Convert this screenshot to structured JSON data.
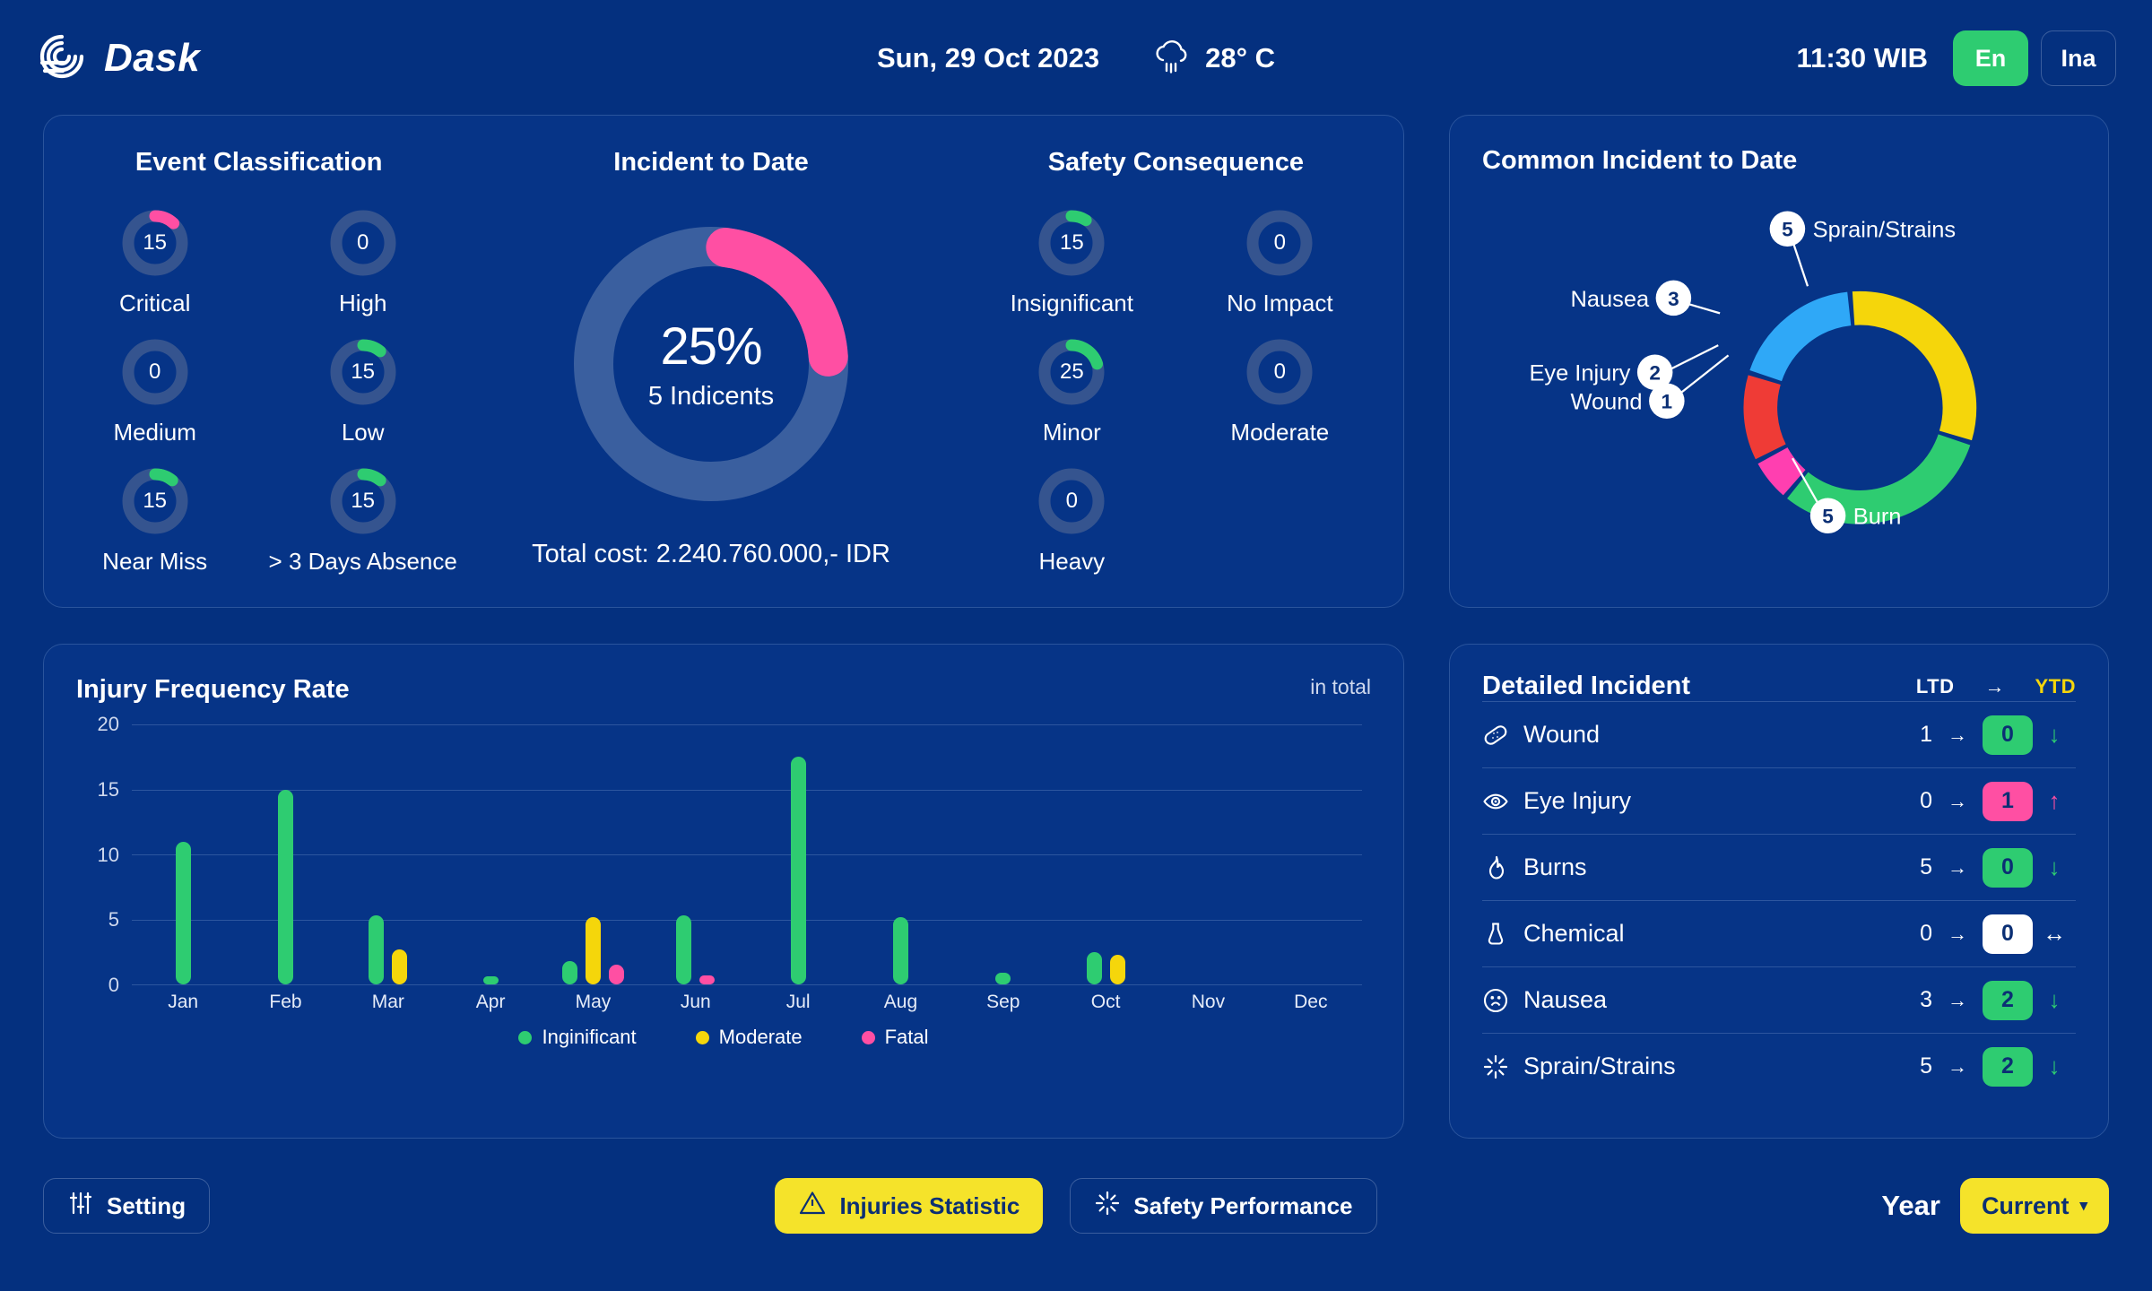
{
  "header": {
    "brand": "Dask",
    "logo_icon": "dask-spiral-logo",
    "date": "Sun, 29 Oct 2023",
    "weather_icon": "rain-cloud-icon",
    "temperature": "28° C",
    "time": "11:30 WIB",
    "lang_active": "En",
    "lang_inactive": "Ina"
  },
  "event_classification": {
    "title": "Event Classification",
    "items": [
      {
        "label": "Critical",
        "value": "15",
        "pct": 12,
        "color": "#ff4fa3"
      },
      {
        "label": "High",
        "value": "0",
        "pct": 0,
        "color": "#2ecc71"
      },
      {
        "label": "Medium",
        "value": "0",
        "pct": 0,
        "color": "#2ecc71"
      },
      {
        "label": "Low",
        "value": "15",
        "pct": 11,
        "color": "#2ecc71"
      },
      {
        "label": "Near Miss",
        "value": "15",
        "pct": 11,
        "color": "#2ecc71"
      },
      {
        "label": "> 3 Days Absence",
        "value": "15",
        "pct": 11,
        "color": "#2ecc71"
      }
    ]
  },
  "incident_to_date": {
    "title": "Incident to Date",
    "percent": "25%",
    "subtitle": "5 Indicents",
    "total_cost": "Total cost: 2.240.760.000,- IDR",
    "arc_pct": 22,
    "arc_color": "#ff4fa3",
    "track_color": "#3a5f9f"
  },
  "safety_consequence": {
    "title": "Safety Consequence",
    "items": [
      {
        "label": "Insignificant",
        "value": "15",
        "pct": 9,
        "color": "#2ecc71"
      },
      {
        "label": "No Impact",
        "value": "0",
        "pct": 0,
        "color": "#2ecc71"
      },
      {
        "label": "Minor",
        "value": "25",
        "pct": 20,
        "color": "#2ecc71"
      },
      {
        "label": "Moderate",
        "value": "0",
        "pct": 0,
        "color": "#2ecc71"
      },
      {
        "label": "Heavy",
        "value": "0",
        "pct": 0,
        "color": "#2ecc71"
      }
    ]
  },
  "common_incident": {
    "title": "Common Incident to Date",
    "chart_data": {
      "type": "pie",
      "title": "Common Incident to Date",
      "categories": [
        "Sprain/Strains",
        "Burn",
        "Wound",
        "Eye Injury",
        "Nausea"
      ],
      "values": [
        5,
        5,
        1,
        2,
        3
      ],
      "colors": [
        "#f5d60b",
        "#2ecc71",
        "#ff3fb0",
        "#ef3b36",
        "#2fa8f7"
      ],
      "legend": "callout-labels"
    },
    "labels": [
      {
        "name": "Sprain/Strains",
        "value": "5"
      },
      {
        "name": "Burn",
        "value": "5"
      },
      {
        "name": "Wound",
        "value": "1"
      },
      {
        "name": "Eye Injury",
        "value": "2"
      },
      {
        "name": "Nausea",
        "value": "3"
      }
    ]
  },
  "injury_chart": {
    "title": "Injury Frequency Rate",
    "total_label": "in total",
    "chart_data": {
      "type": "bar",
      "title": "Injury Frequency Rate",
      "xlabel": "",
      "ylabel": "",
      "ylim": [
        0,
        20
      ],
      "yticks": [
        0,
        5,
        10,
        15,
        20
      ],
      "grid": true,
      "categories": [
        "Jan",
        "Feb",
        "Mar",
        "Apr",
        "May",
        "Jun",
        "Jul",
        "Aug",
        "Sep",
        "Oct",
        "Nov",
        "Dec"
      ],
      "series": [
        {
          "name": "Inginificant",
          "color": "#2ecc71",
          "values": [
            11,
            15,
            5.3,
            0.6,
            1.8,
            5.3,
            17.5,
            5.2,
            0.9,
            2.5,
            0,
            0
          ]
        },
        {
          "name": "Moderate",
          "color": "#f5d60b",
          "values": [
            0,
            0,
            2.7,
            0,
            5.2,
            0,
            0,
            0,
            0,
            2.3,
            0,
            0
          ]
        },
        {
          "name": "Fatal",
          "color": "#ff4fa3",
          "values": [
            0,
            0,
            0,
            0,
            1.5,
            0.7,
            0,
            0,
            0,
            0,
            0,
            0
          ]
        }
      ]
    },
    "legend": [
      {
        "label": "Inginificant",
        "color": "#2ecc71"
      },
      {
        "label": "Moderate",
        "color": "#f5d60b"
      },
      {
        "label": "Fatal",
        "color": "#ff4fa3"
      }
    ]
  },
  "detailed_incident": {
    "title": "Detailed Incident",
    "col_ltd": "LTD",
    "col_arrow": "→",
    "col_ytd": "YTD",
    "rows": [
      {
        "icon": "bandage-icon",
        "label": "Wound",
        "ltd": "1",
        "arrow": "→",
        "ytd": "0",
        "badge_color": "#2ecc71",
        "trend": "↓",
        "trend_color": "#2ecc71"
      },
      {
        "icon": "eye-icon",
        "label": "Eye Injury",
        "ltd": "0",
        "arrow": "→",
        "ytd": "1",
        "badge_color": "#ff4fa3",
        "trend": "↑",
        "trend_color": "#ff4fa3"
      },
      {
        "icon": "flame-icon",
        "label": "Burns",
        "ltd": "5",
        "arrow": "→",
        "ytd": "0",
        "badge_color": "#2ecc71",
        "trend": "↓",
        "trend_color": "#2ecc71"
      },
      {
        "icon": "flask-icon",
        "label": "Chemical",
        "ltd": "0",
        "arrow": "→",
        "ytd": "0",
        "badge_color": "#ffffff",
        "trend": "↔",
        "trend_color": "#ffffff"
      },
      {
        "icon": "nausea-face-icon",
        "label": "Nausea",
        "ltd": "3",
        "arrow": "→",
        "ytd": "2",
        "badge_color": "#2ecc71",
        "trend": "↓",
        "trend_color": "#2ecc71"
      },
      {
        "icon": "sparkle-burst-icon",
        "label": "Sprain/Strains",
        "ltd": "5",
        "arrow": "→",
        "ytd": "2",
        "badge_color": "#2ecc71",
        "trend": "↓",
        "trend_color": "#2ecc71"
      }
    ]
  },
  "footer": {
    "setting_label": "Setting",
    "setting_icon": "sliders-icon",
    "injuries_label": "Injuries Statistic",
    "injuries_icon": "warning-triangle-icon",
    "performance_label": "Safety Performance",
    "performance_icon": "sparkle-burst-icon",
    "year_label": "Year",
    "year_value": "Current",
    "year_caret": "▾"
  },
  "colors": {
    "page_bg": "#04307f",
    "card_bg": "#063487",
    "green": "#2ecc71",
    "pink": "#ff4fa3",
    "yellow": "#f5d60b",
    "red": "#ef3b36",
    "blue": "#2fa8f7"
  }
}
